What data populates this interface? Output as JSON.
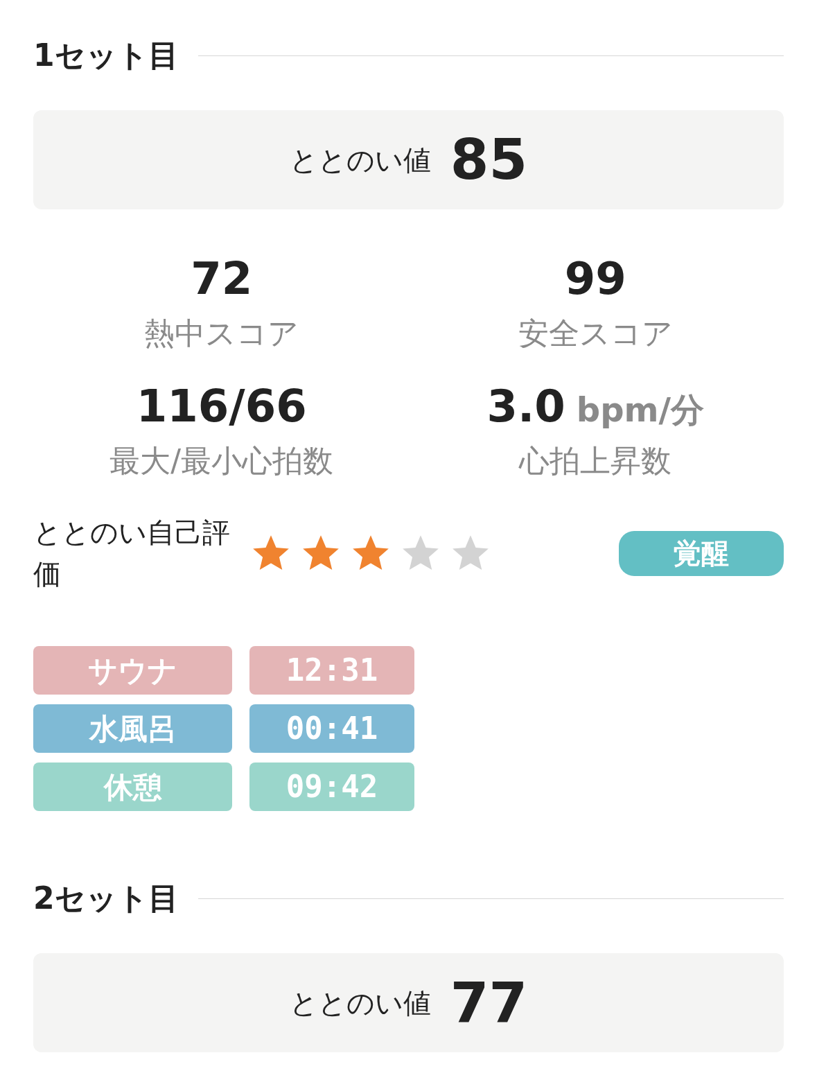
{
  "sets": [
    {
      "title": "1セット目",
      "score_label": "ととのい値",
      "score": "85",
      "stats": [
        {
          "value": "72",
          "label": "熱中スコア"
        },
        {
          "value": "99",
          "label": "安全スコア"
        },
        {
          "value": "116/66",
          "label": "最大/最小心拍数"
        },
        {
          "value": "3.0",
          "unit": "bpm/分",
          "label": "心拍上昇数"
        }
      ],
      "rating": {
        "label": "ととのい自己評価",
        "stars": 3,
        "badge": "覚醒"
      },
      "phases": [
        {
          "label": "サウナ",
          "time": "12:31",
          "color": "#e4b5b6"
        },
        {
          "label": "水風呂",
          "time": "00:41",
          "color": "#7fbad5"
        },
        {
          "label": "休憩",
          "time": "09:42",
          "color": "#9ad6cb"
        }
      ]
    },
    {
      "title": "2セット目",
      "score_label": "ととのい値",
      "score": "77"
    }
  ]
}
